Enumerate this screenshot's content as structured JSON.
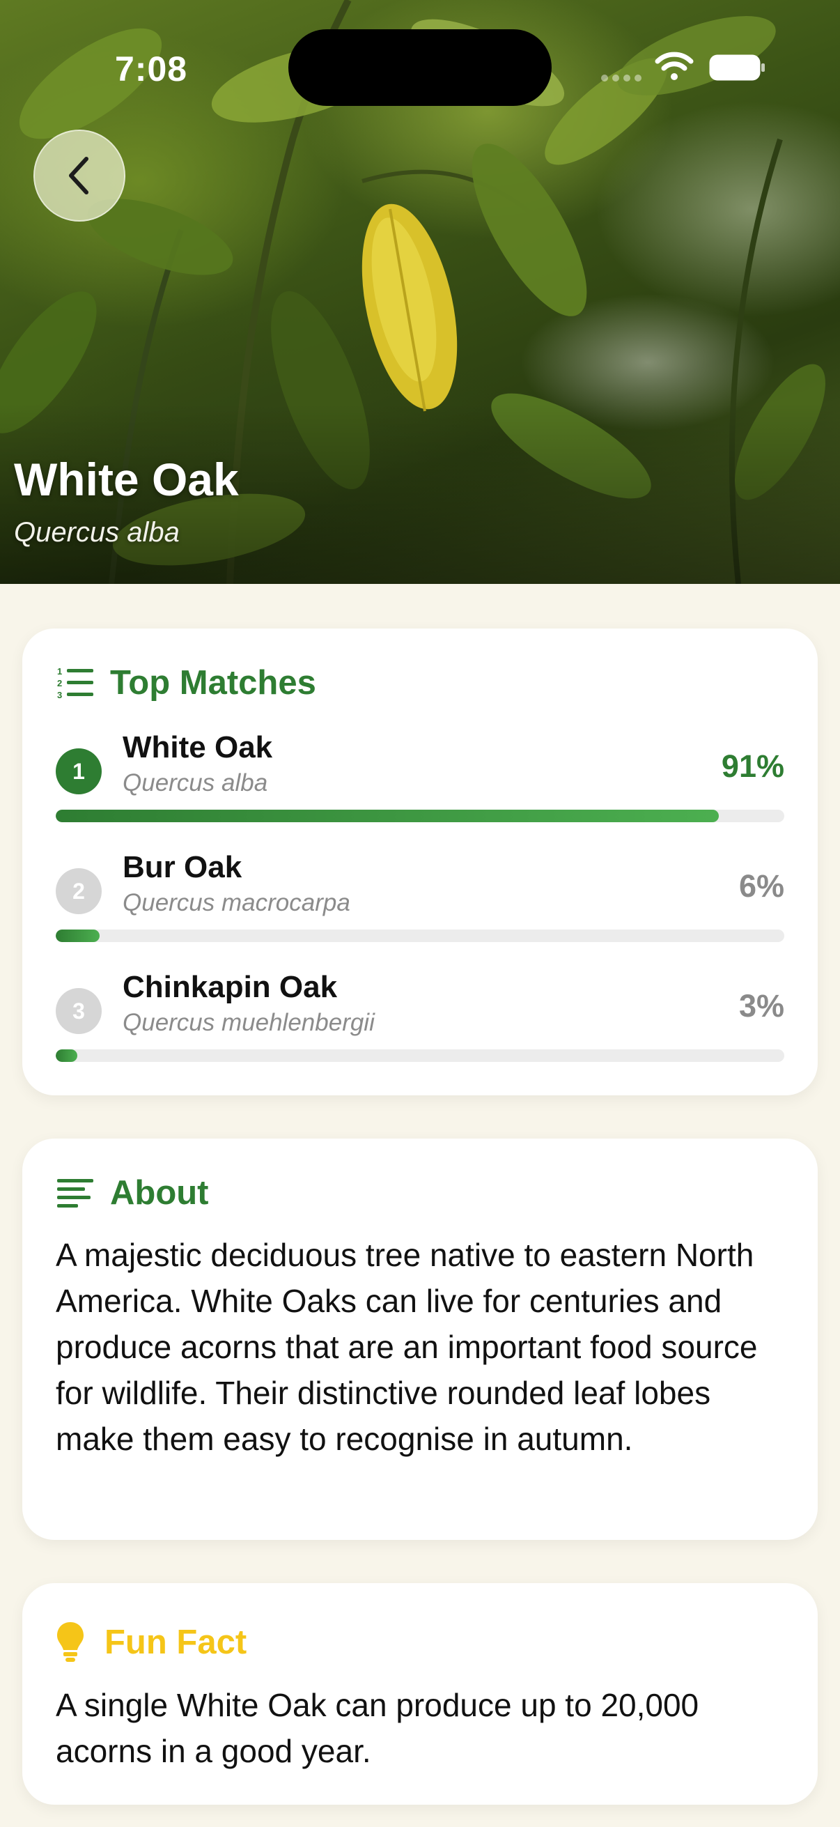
{
  "status_bar": {
    "time": "7:08"
  },
  "hero": {
    "title": "White Oak",
    "subtitle": "Quercus alba",
    "back_icon": "chevron-left-icon"
  },
  "top_matches": {
    "header_icon": "numbered-list-icon",
    "title": "Top Matches",
    "items": [
      {
        "rank": "1",
        "name": "White Oak",
        "scientific": "Quercus alba",
        "percent_label": "91%",
        "confidence": 0.91,
        "highlight": true
      },
      {
        "rank": "2",
        "name": "Bur Oak",
        "scientific": "Quercus macrocarpa",
        "percent_label": "6%",
        "confidence": 0.06,
        "highlight": false
      },
      {
        "rank": "3",
        "name": "Chinkapin Oak",
        "scientific": "Quercus muehlenbergii",
        "percent_label": "3%",
        "confidence": 0.03,
        "highlight": false
      }
    ]
  },
  "about": {
    "header_icon": "text-lines-icon",
    "title": "About",
    "text": "A majestic deciduous tree native to eastern North America. White Oaks can live for centuries and produce acorns that are an important food source for wildlife. Their distinctive rounded leaf lobes make them easy to recognise in autumn."
  },
  "fun_fact": {
    "header_icon": "lightbulb-icon",
    "title": "Fun Fact",
    "text": "A single White Oak can produce up to 20,000 acorns in a good year."
  },
  "colors": {
    "accent_green": "#2e7d32",
    "fact_yellow": "#f5c518",
    "muted_rank": "#d6d6d6",
    "muted_percent": "#8a8a8a",
    "background": "#f8f5ea"
  }
}
